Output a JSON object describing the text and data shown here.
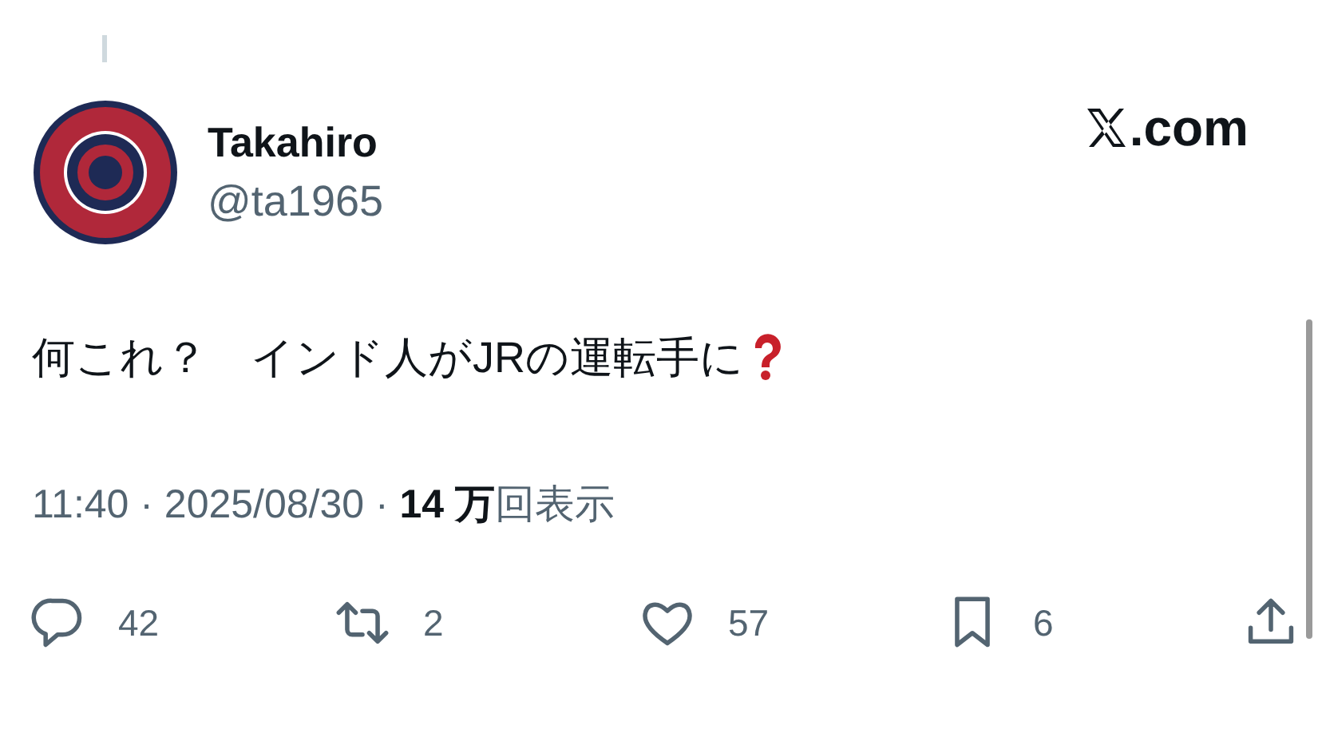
{
  "author": {
    "name": "Takahiro",
    "handle": "@ta1965"
  },
  "site": {
    "label": ".com"
  },
  "post": {
    "text": "何これ？　インド人がJRの運転手に"
  },
  "meta": {
    "line": "11:40 · 2025/08/30 · **14 万**回表示"
  },
  "actions": [
    {
      "kind": "reply",
      "count": "42"
    },
    {
      "kind": "repost",
      "count": "2"
    },
    {
      "kind": "like",
      "count": "57"
    },
    {
      "kind": "bookmark",
      "count": "6"
    },
    {
      "kind": "share"
    }
  ]
}
